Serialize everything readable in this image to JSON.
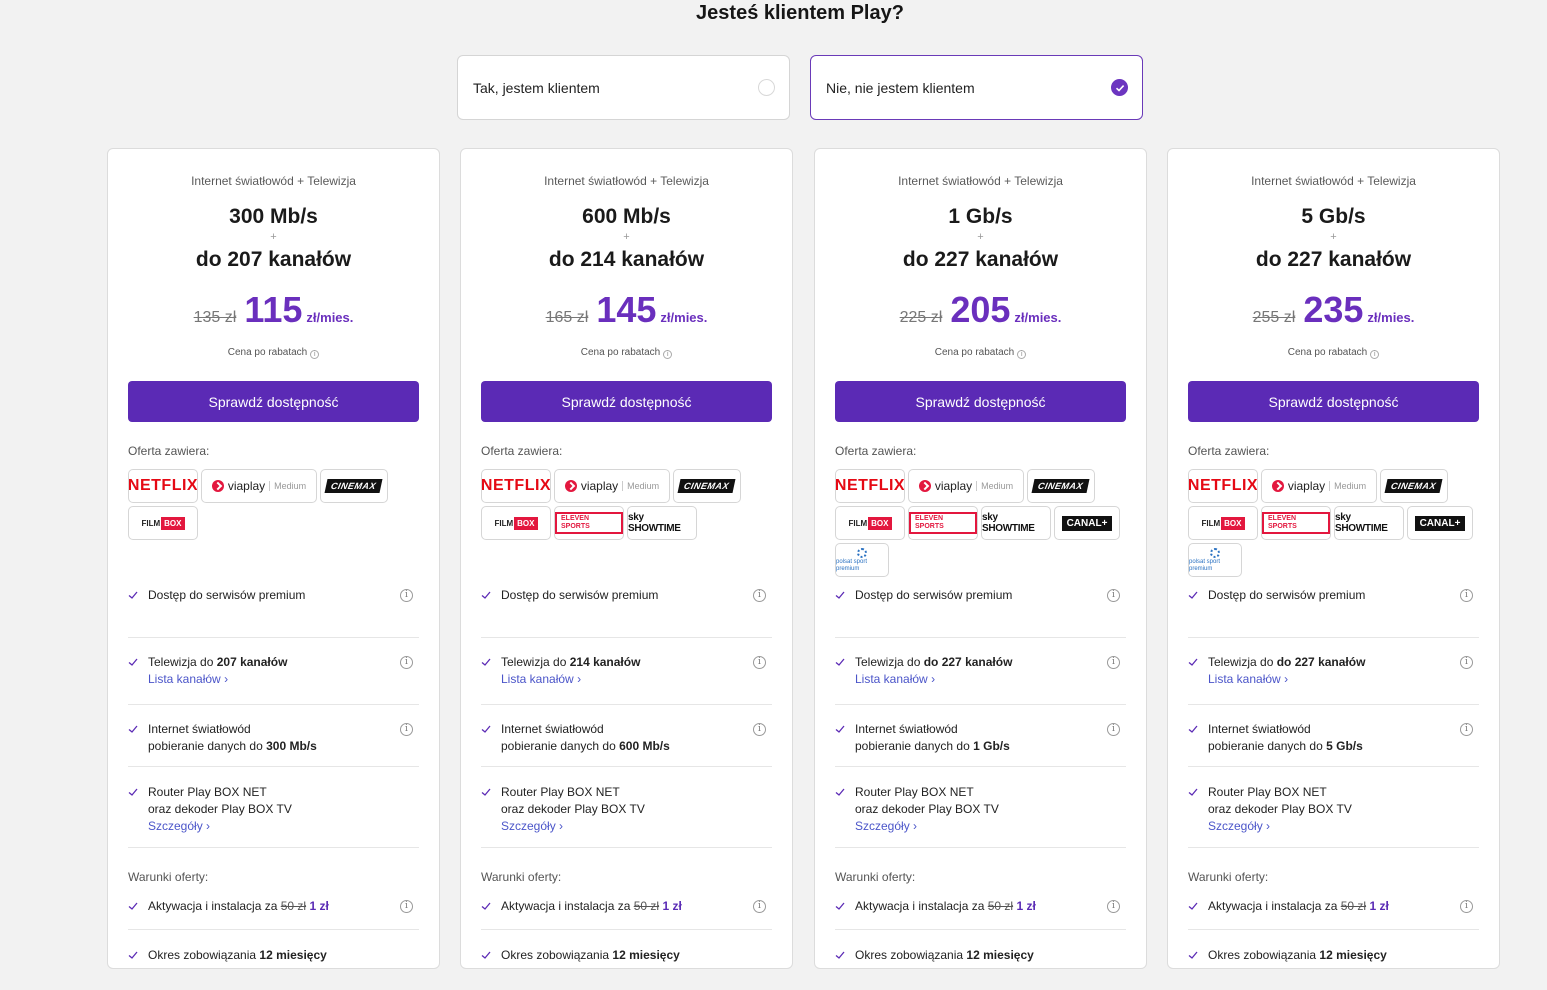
{
  "header": {
    "title": "Jesteś klientem Play?"
  },
  "choices": [
    {
      "label": "Tak, jestem klientem",
      "selected": false
    },
    {
      "label": "Nie, nie jestem klientem",
      "selected": true
    }
  ],
  "common": {
    "subtitle": "Internet światłowód + Telewizja",
    "plus": "+",
    "price_note": "Cena po rabatach",
    "unit": "zł/mies.",
    "button": "Sprawdź dostępność",
    "offer_label": "Oferta zawiera:",
    "premium": "Dostęp do serwisów premium",
    "tv_prefix": "Telewizja do",
    "channel_list_link": "Lista kanałów",
    "internet_title": "Internet światłowód",
    "internet_prefix": "pobieranie danych do",
    "router_line1": "Router Play BOX NET",
    "router_line2": "oraz dekoder Play BOX TV",
    "details_link": "Szczegóły",
    "terms_label": "Warunki oferty:",
    "activation_prefix": "Aktywacja i instalacja za",
    "activation_old": "50 zł",
    "activation_new": "1 zł",
    "commitment_prefix": "Okres zobowiązania",
    "commitment_value": "12 miesięcy"
  },
  "plans": [
    {
      "speed": "300 Mb/s",
      "channels": "do 207 kanałów",
      "old_price": "135 zł",
      "new_price": "115",
      "tv_channels": "207 kanałów",
      "download": "300 Mb/s",
      "logos": [
        "netflix",
        "viaplay",
        "cinemax",
        "filmbox"
      ]
    },
    {
      "speed": "600 Mb/s",
      "channels": "do 214 kanałów",
      "old_price": "165 zł",
      "new_price": "145",
      "tv_channels": "214 kanałów",
      "download": "600 Mb/s",
      "logos": [
        "netflix",
        "viaplay",
        "cinemax",
        "filmbox",
        "eleven",
        "sky"
      ]
    },
    {
      "speed": "1 Gb/s",
      "channels": "do 227 kanałów",
      "old_price": "225 zł",
      "new_price": "205",
      "tv_channels": "do 227 kanałów",
      "download": "1 Gb/s",
      "logos": [
        "netflix",
        "viaplay",
        "cinemax",
        "filmbox",
        "eleven",
        "sky",
        "canal",
        "polsat"
      ]
    },
    {
      "speed": "5 Gb/s",
      "channels": "do 227 kanałów",
      "old_price": "255 zł",
      "new_price": "235",
      "tv_channels": "do 227 kanałów",
      "download": "5 Gb/s",
      "logos": [
        "netflix",
        "viaplay",
        "cinemax",
        "filmbox",
        "eleven",
        "sky",
        "canal",
        "polsat"
      ]
    }
  ],
  "logo_text": {
    "netflix": "NETFLIX",
    "viaplay": "viaplay",
    "viaplay_tier": "Medium",
    "cinemax": "CINEMAX",
    "filmbox_a": "FILM",
    "filmbox_b": "BOX",
    "eleven": "ELEVEN SPORTS",
    "sky": "sky SHOWTIME",
    "canal": "CANAL+",
    "polsat": "polsat sport premium"
  },
  "colors": {
    "accent": "#5b2ab5",
    "price": "#6a2fbd",
    "link": "#4b55c9",
    "netflix": "#e50914"
  }
}
